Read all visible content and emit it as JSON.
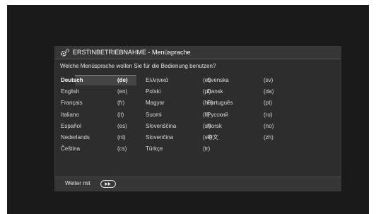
{
  "dialog": {
    "title": "ERSTINBETRIEBNAHME - Menüsprache",
    "question": "Welche Menüsprache wollen Sie für die Bedienung benutzen?",
    "footer_label": "Weiter mit"
  },
  "languages": [
    {
      "name": "Deutsch",
      "code": "(de)",
      "selected": true
    },
    {
      "name": "English",
      "code": "(en)"
    },
    {
      "name": "Français",
      "code": "(fr)"
    },
    {
      "name": "Italiano",
      "code": "(it)"
    },
    {
      "name": "Español",
      "code": "(es)"
    },
    {
      "name": "Nederlands",
      "code": "(nl)"
    },
    {
      "name": "Čeština",
      "code": "(cs)"
    },
    {
      "name": "Ελληνικά",
      "code": "(el)"
    },
    {
      "name": "Polski",
      "code": "(pl)"
    },
    {
      "name": "Magyar",
      "code": "(hu)"
    },
    {
      "name": "Suomi",
      "code": "(fi)"
    },
    {
      "name": "Slovenščina",
      "code": "(sl)"
    },
    {
      "name": "Slovenčina",
      "code": "(sk)"
    },
    {
      "name": "Türkçe",
      "code": "(tr)"
    },
    {
      "name": "Svenska",
      "code": "(sv)"
    },
    {
      "name": "Dansk",
      "code": "(da)"
    },
    {
      "name": "Português",
      "code": "(pt)"
    },
    {
      "name": "Русский",
      "code": "(ru)"
    },
    {
      "name": "Norsk",
      "code": "(no)"
    },
    {
      "name": "中文",
      "code": "(zh)"
    }
  ],
  "icons": {
    "title": "gears-icon",
    "footer": "fast-forward-button-icon"
  },
  "colors": {
    "screen_bg": "#1a1a1a",
    "dialog_bg": "#2d2d2d",
    "selection_bg": "#454545",
    "text": "#d8d8d8"
  }
}
